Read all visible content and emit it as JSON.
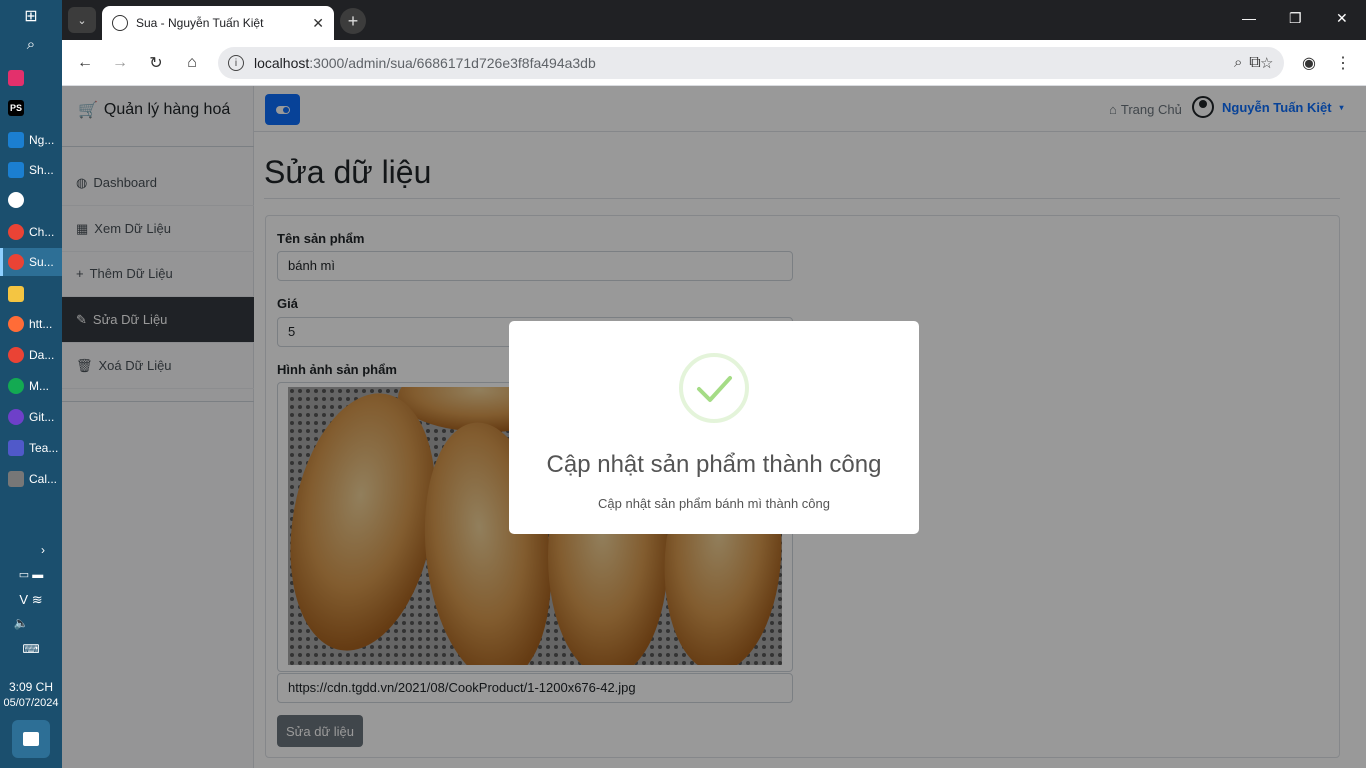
{
  "taskbar": {
    "items": [
      {
        "label": "Ng...",
        "icon": "webstorm-icon",
        "color": "#1b7fd1"
      },
      {
        "label": "Sh...",
        "icon": "webstorm-icon",
        "color": "#1b7fd1"
      },
      {
        "label": "Ch...",
        "icon": "chrome-icon",
        "color": "#ea4335"
      },
      {
        "label": "Su...",
        "icon": "chrome-icon",
        "color": "#ea4335"
      },
      {
        "label": "htt...",
        "icon": "postman-icon",
        "color": "#ff6c37"
      },
      {
        "label": "Da...",
        "icon": "chrome-icon",
        "color": "#ea4335"
      },
      {
        "label": "M...",
        "icon": "mongodb-icon",
        "color": "#13aa52"
      },
      {
        "label": "Git...",
        "icon": "github-icon",
        "color": "#6e40c9"
      },
      {
        "label": "Tea...",
        "icon": "teams-icon",
        "color": "#5059c9"
      },
      {
        "label": "Cal...",
        "icon": "calculator-icon",
        "color": "#555"
      }
    ],
    "time": "3:09 CH",
    "date": "05/07/2024"
  },
  "browser": {
    "tab_title": "Sua - Nguyễn Tuấn Kiệt",
    "url_host": "localhost",
    "url_rest": ":3000/admin/sua/6686171d726e3f8fa494a3db"
  },
  "sidebar": {
    "brand": "Quản lý hàng hoá",
    "items": [
      {
        "label": "Dashboard",
        "icon": "dashboard-icon"
      },
      {
        "label": "Xem Dữ Liệu",
        "icon": "table-icon"
      },
      {
        "label": "Thêm Dữ Liệu",
        "icon": "plus-icon"
      },
      {
        "label": "Sửa Dữ Liệu",
        "icon": "pencil-icon"
      },
      {
        "label": "Xoá Dữ Liệu",
        "icon": "trash-icon"
      }
    ]
  },
  "topbar": {
    "home_label": "Trang Chủ",
    "user_name": "Nguyễn Tuấn Kiệt"
  },
  "form": {
    "title": "Sửa dữ liệu",
    "name_label": "Tên sản phẩm",
    "name_value": "bánh mì",
    "price_label": "Giá",
    "price_value": "5",
    "image_label": "Hình ảnh sản phẩm",
    "image_url": "https://cdn.tgdd.vn/2021/08/CookProduct/1-1200x676-42.jpg",
    "submit_label": "Sửa dữ liệu"
  },
  "modal": {
    "title": "Cập nhật sản phẩm thành công",
    "text": "Cập nhật sản phẩm bánh mì thành công",
    "success_color": "#a5dc86"
  }
}
